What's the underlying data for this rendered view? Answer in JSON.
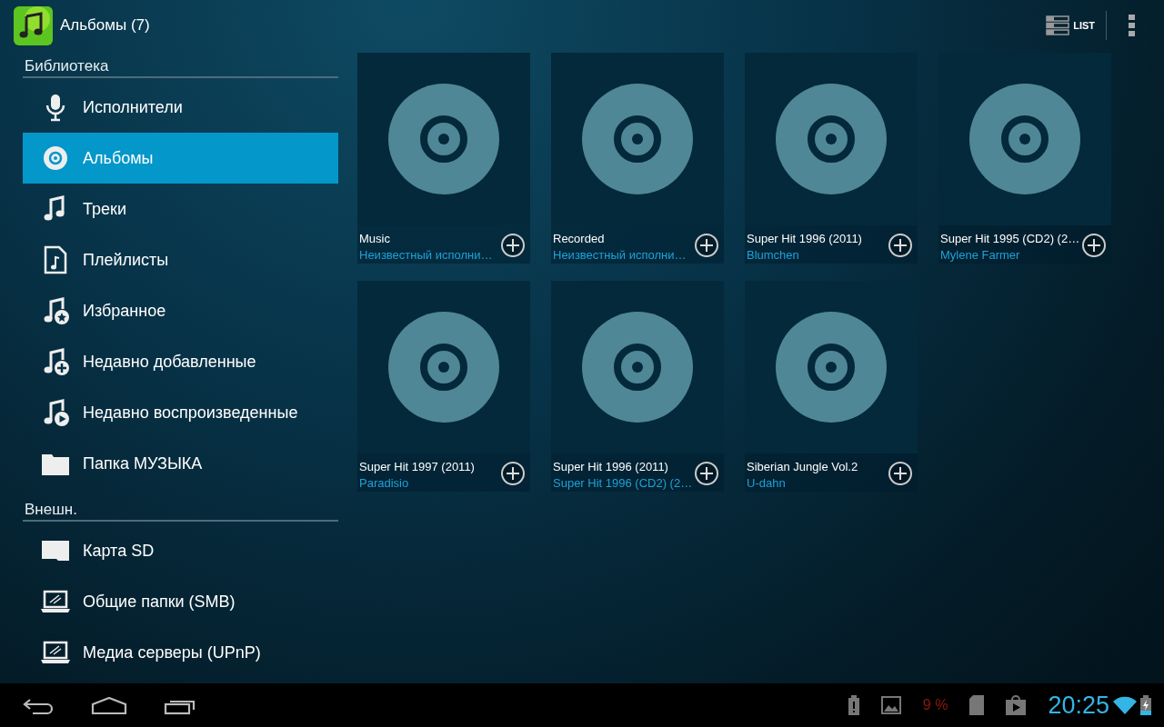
{
  "action_bar": {
    "title": "Альбомы (7)",
    "view_button": "LIST"
  },
  "sidebar": {
    "sections": [
      {
        "title": "Библиотека",
        "items": [
          {
            "kind": "mic",
            "label": "Исполнители",
            "selected": false
          },
          {
            "kind": "disc",
            "label": "Альбомы",
            "selected": true
          },
          {
            "kind": "note",
            "label": "Треки",
            "selected": false
          },
          {
            "kind": "playlist",
            "label": "Плейлисты",
            "selected": false
          },
          {
            "kind": "note-star",
            "label": "Избранное",
            "selected": false
          },
          {
            "kind": "note-plus",
            "label": "Недавно добавленные",
            "selected": false
          },
          {
            "kind": "note-play",
            "label": "Недавно воспроизведенные",
            "selected": false
          },
          {
            "kind": "folder",
            "label": "Папка МУЗЫКА",
            "selected": false
          }
        ]
      },
      {
        "title": "Внешн.",
        "items": [
          {
            "kind": "sd",
            "label": "Карта SD",
            "selected": false
          },
          {
            "kind": "laptop",
            "label": "Общие папки (SMB)",
            "selected": false
          },
          {
            "kind": "laptop",
            "label": "Медиа серверы (UPnP)",
            "selected": false
          }
        ]
      }
    ]
  },
  "albums": [
    {
      "title": "Music",
      "artist": "Неизвестный исполни…"
    },
    {
      "title": "Recorded",
      "artist": "Неизвестный исполни…"
    },
    {
      "title": "Super Hit 1996 (2011)",
      "artist": "Blumchen"
    },
    {
      "title": "Super Hit 1995 (CD2) (2…",
      "artist": "Mylene Farmer"
    },
    {
      "title": "Super Hit 1997 (2011)",
      "artist": "Paradisio"
    },
    {
      "title": "Super Hit 1996 (2011)",
      "artist": "Super Hit 1996 (CD2) (2…"
    },
    {
      "title": "Siberian Jungle Vol.2",
      "artist": "U-dahn"
    }
  ],
  "status_bar": {
    "battery_percent": "9 %",
    "time": "20:25"
  }
}
